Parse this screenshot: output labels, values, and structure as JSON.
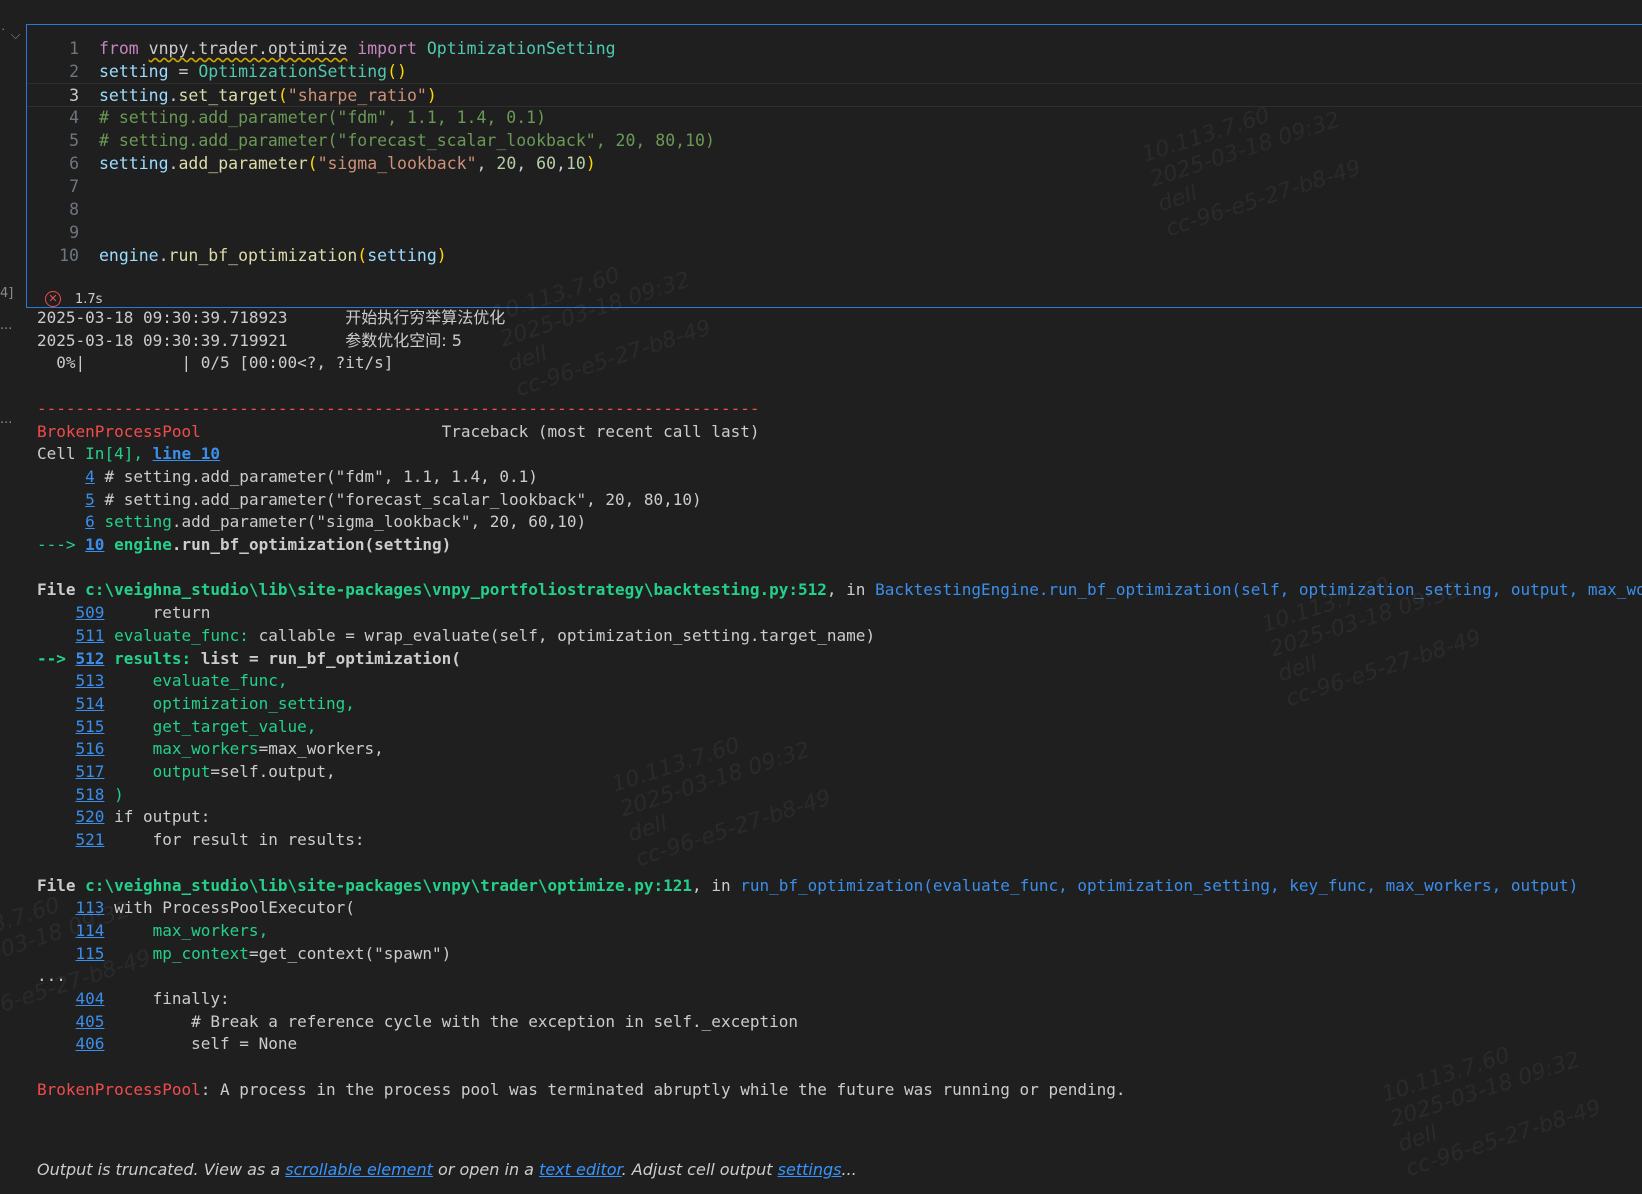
{
  "left_gutter": {
    "collapse_marker": "˙ ⌵",
    "exec_count": "4]",
    "out_marker_1": "...",
    "out_marker_2": "..."
  },
  "cell": {
    "lines": [
      {
        "n": "1",
        "parts": [
          [
            "kw",
            "from "
          ],
          [
            "mod",
            "vnpy.trader.optimize"
          ],
          [
            "kw",
            " import "
          ],
          [
            "cls",
            "OptimizationSetting"
          ]
        ]
      },
      {
        "n": "2",
        "parts": [
          [
            "var",
            "setting"
          ],
          [
            "plain",
            " = "
          ],
          [
            "cls",
            "OptimizationSetting"
          ],
          [
            "paren",
            "()"
          ]
        ]
      },
      {
        "n": "3",
        "parts": [
          [
            "var",
            "setting"
          ],
          [
            "plain",
            "."
          ],
          [
            "fn",
            "set_target"
          ],
          [
            "paren",
            "("
          ],
          [
            "str",
            "\"sharpe_ratio\""
          ],
          [
            "paren",
            ")"
          ]
        ]
      },
      {
        "n": "4",
        "parts": [
          [
            "cmt",
            "# setting.add_parameter(\"fdm\", 1.1, 1.4, 0.1)"
          ]
        ]
      },
      {
        "n": "5",
        "parts": [
          [
            "cmt",
            "# setting.add_parameter(\"forecast_scalar_lookback\", 20, 80,10)"
          ]
        ]
      },
      {
        "n": "6",
        "parts": [
          [
            "var",
            "setting"
          ],
          [
            "plain",
            "."
          ],
          [
            "fn",
            "add_parameter"
          ],
          [
            "paren",
            "("
          ],
          [
            "str",
            "\"sigma_lookback\""
          ],
          [
            "plain",
            ", "
          ],
          [
            "num",
            "20"
          ],
          [
            "plain",
            ", "
          ],
          [
            "num",
            "60"
          ],
          [
            "plain",
            ","
          ],
          [
            "num",
            "10"
          ],
          [
            "paren",
            ")"
          ]
        ]
      },
      {
        "n": "7",
        "parts": []
      },
      {
        "n": "8",
        "parts": []
      },
      {
        "n": "9",
        "parts": []
      },
      {
        "n": "10",
        "parts": [
          [
            "var",
            "engine"
          ],
          [
            "plain",
            "."
          ],
          [
            "fn",
            "run_bf_optimization"
          ],
          [
            "paren",
            "("
          ],
          [
            "var",
            "setting"
          ],
          [
            "paren",
            ")"
          ]
        ]
      }
    ],
    "status_time": "1.7s"
  },
  "output": {
    "log1_time": "2025-03-18 09:30:39.718923",
    "log1_msg": "开始执行穷举算法优化",
    "log2_time": "2025-03-18 09:30:39.719921",
    "log2_msg": "参数优化空间: 5",
    "progress": "  0%|          | 0/5 [00:00<?, ?it/s]",
    "dashes": "---------------------------------------------------------------------------",
    "exc_name": "BrokenProcessPool",
    "traceback_hdr": "                         Traceback (most recent call last)",
    "cell_word": "Cell ",
    "cell_in": "In[4], ",
    "cell_line": "line 10",
    "tb1": [
      {
        "arrow": "     ",
        "n": "4",
        "code": " # setting.add_parameter(\"fdm\", 1.1, 1.4, 0.1)"
      },
      {
        "arrow": "     ",
        "n": "5",
        "code": " # setting.add_parameter(\"forecast_scalar_lookback\", 20, 80,10)"
      },
      {
        "arrow": "     ",
        "n": "6",
        "code_g": " setting",
        "code": ".add_parameter(\"sigma_lookback\", 20, 60,10)"
      },
      {
        "arrow": "---> ",
        "n": "10",
        "code_g": " engine",
        "code": ".run_bf_optimization(setting)"
      }
    ],
    "file1_word": "File ",
    "file1_path": "c:\\veighna_studio\\lib\\site-packages\\vnpy_portfoliostrategy\\backtesting.py:512",
    "file1_in": ", in ",
    "file1_func": "BacktestingEngine.run_bf_optimization(self, optimization_setting, output, max_wo",
    "tb2": [
      {
        "arrow": "    ",
        "n": "509",
        "g": "",
        "code": "     return"
      },
      {
        "arrow": "    ",
        "n": "511",
        "g": " evaluate_func:",
        "code": " callable = wrap_evaluate(self, optimization_setting.target_name)"
      },
      {
        "arrow": "--> ",
        "n": "512",
        "g": " results:",
        "code": " list = run_bf_optimization(",
        "bold": true
      },
      {
        "arrow": "    ",
        "n": "513",
        "g": "     evaluate_func,",
        "code": ""
      },
      {
        "arrow": "    ",
        "n": "514",
        "g": "     optimization_setting,",
        "code": ""
      },
      {
        "arrow": "    ",
        "n": "515",
        "g": "     get_target_value,",
        "code": ""
      },
      {
        "arrow": "    ",
        "n": "516",
        "g": "     max_workers",
        "code": "=max_workers,"
      },
      {
        "arrow": "    ",
        "n": "517",
        "g": "     output",
        "code": "=self.output,"
      },
      {
        "arrow": "    ",
        "n": "518",
        "g": " )",
        "code": ""
      },
      {
        "arrow": "    ",
        "n": "520",
        "g": "",
        "code": " if output:"
      },
      {
        "arrow": "    ",
        "n": "521",
        "g": "",
        "code": "     for result in results:"
      }
    ],
    "file2_word": "File ",
    "file2_path": "c:\\veighna_studio\\lib\\site-packages\\vnpy\\trader\\optimize.py:121",
    "file2_in": ", in ",
    "file2_func": "run_bf_optimization(evaluate_func, optimization_setting, key_func, max_workers, output)",
    "tb3": [
      {
        "arrow": "    ",
        "n": "113",
        "g": "",
        "code": " with ProcessPoolExecutor("
      },
      {
        "arrow": "    ",
        "n": "114",
        "g": "     max_workers,",
        "code": ""
      },
      {
        "arrow": "    ",
        "n": "115",
        "g": "     mp_context",
        "code": "=get_context(\"spawn\")"
      }
    ],
    "ellipsis": "...",
    "tb4": [
      {
        "arrow": "    ",
        "n": "404",
        "g": "",
        "code": "     finally:"
      },
      {
        "arrow": "    ",
        "n": "405",
        "g": "",
        "code": "         # Break a reference cycle with the exception in self._exception"
      },
      {
        "arrow": "    ",
        "n": "406",
        "g": "",
        "code": "         self = None"
      }
    ],
    "final_exc": "BrokenProcessPool",
    "final_msg": ": A process in the process pool was terminated abruptly while the future was running or pending.",
    "trunc_a": "Output is truncated. View as a ",
    "trunc_link1": "scrollable element",
    "trunc_b": " or open in a ",
    "trunc_link2": "text editor",
    "trunc_c": ". Adjust cell output ",
    "trunc_link3": "settings",
    "trunc_d": "..."
  },
  "watermark": "10.113.7.60\n2025-03-18 09:32\ndell\ncc-96-e5-27-b8-49"
}
